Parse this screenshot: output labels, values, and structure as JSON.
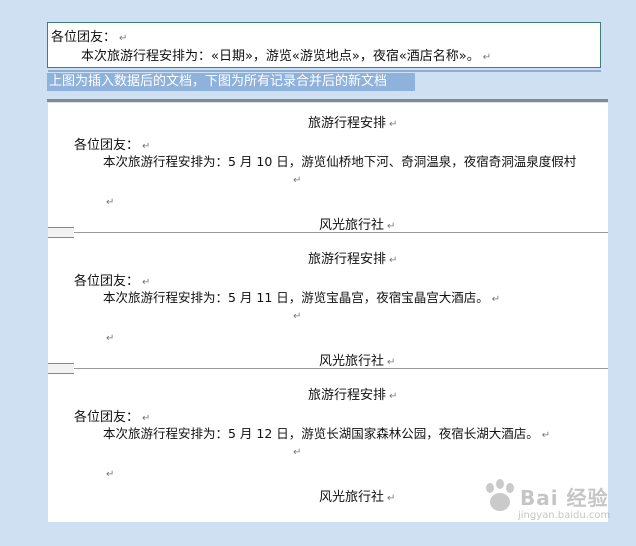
{
  "template": {
    "greeting": "各位团友：",
    "body": "本次旅游行程安排为：«日期»，游览«游览地点»，夜宿«酒店名称»。"
  },
  "caption": "上图为插入数据后的文档，下图为所有记录合并后的新文档",
  "para_mark": "↵",
  "records": [
    {
      "title": "旅游行程安排",
      "greeting": "各位团友：",
      "body": "本次旅游行程安排为：5 月 10 日，游览仙桥地下河、奇洞温泉，夜宿奇洞温泉度假村",
      "signature": "风光旅行社"
    },
    {
      "title": "旅游行程安排",
      "greeting": "各位团友：",
      "body": "本次旅游行程安排为：5 月 11 日，游览宝晶宫，夜宿宝晶宫大酒店。",
      "signature": "风光旅行社"
    },
    {
      "title": "旅游行程安排",
      "greeting": "各位团友：",
      "body": "本次旅游行程安排为：5 月 12 日，游览长湖国家森林公园，夜宿长湖大酒店。",
      "signature": "风光旅行社"
    }
  ],
  "watermark": {
    "text": "Bai 经验",
    "url": "jingyan.baidu.com"
  }
}
